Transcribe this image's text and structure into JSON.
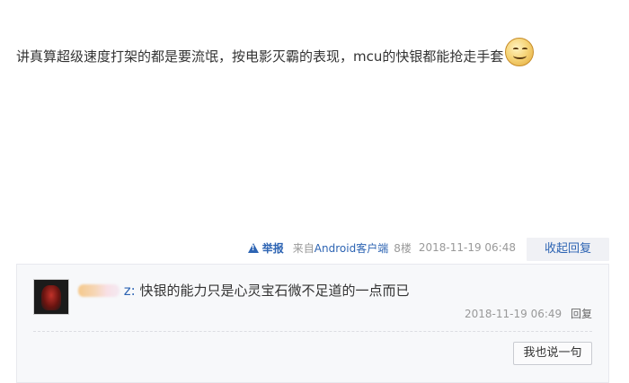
{
  "post": {
    "content": "讲真算超级速度打架的都是要流氓，按电影灭霸的表现，mcu的快银都能抢走手套",
    "emoji": "smiley-emoji"
  },
  "meta": {
    "report_label": "举报",
    "from_prefix": "来自",
    "from_client": "Android客户端",
    "floor": "8楼",
    "time": "2018-11-19 06:48",
    "collapse_label": "收起回复"
  },
  "reply": {
    "username_visible": "z:",
    "text": "快银的能力只是心灵宝石微不足道的一点而已",
    "time": "2018-11-19 06:49",
    "reply_label": "回复"
  },
  "composer": {
    "say_label": "我也说一句"
  },
  "colors": {
    "link": "#2d64b3",
    "meta_gray": "#999999",
    "panel_bg": "#f7f8fa"
  }
}
